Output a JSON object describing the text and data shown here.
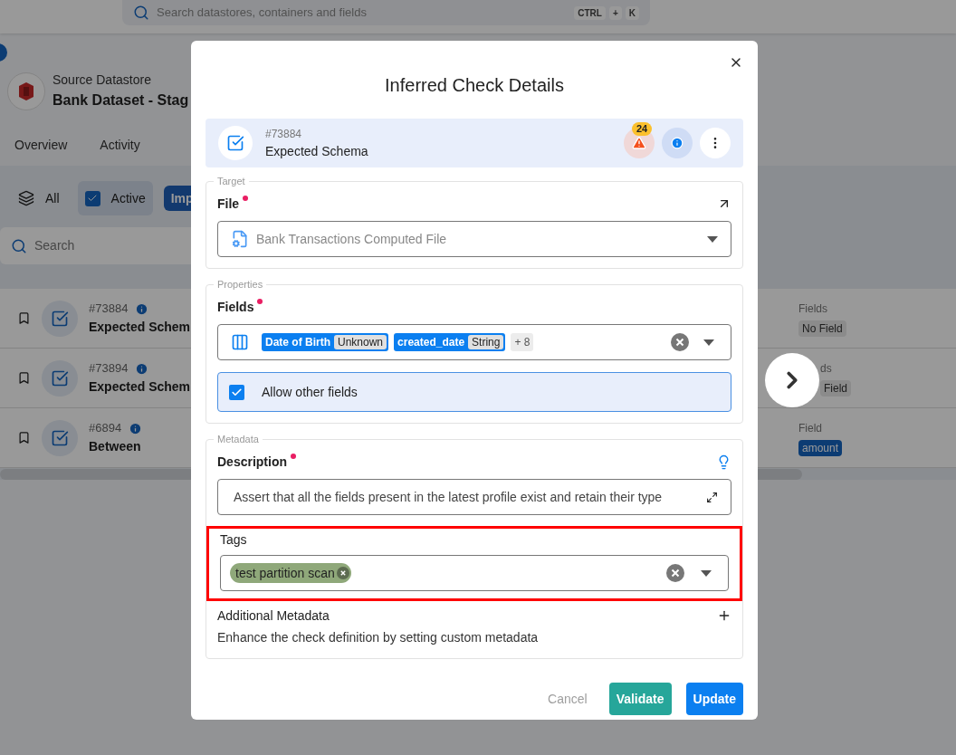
{
  "global_search": {
    "placeholder": "Search datastores, containers and fields",
    "shortcut": [
      "CTRL",
      "+",
      "K"
    ]
  },
  "datastore": {
    "caption": "Source Datastore",
    "name": "Bank Dataset - Stag"
  },
  "tabs": [
    {
      "label": "Overview",
      "selected": false
    },
    {
      "label": "Activity",
      "selected": false
    }
  ],
  "filters": [
    {
      "label": "All",
      "kind": "layers",
      "selected": false
    },
    {
      "label": "Active",
      "kind": "checkbox",
      "selected": true
    }
  ],
  "filter_button": "Imp",
  "list_search": {
    "placeholder": "Search"
  },
  "checks": [
    {
      "id": "#73884",
      "name": "Expected Schem",
      "field_label": "Fields",
      "field_value": "No Field",
      "kind": "empty"
    },
    {
      "id": "#73894",
      "name": "Expected Schem",
      "field_label": "ds",
      "field_value": "Field",
      "kind": "empty"
    },
    {
      "id": "#6894",
      "name": "Between",
      "field_label": "Field",
      "field_value": "amount",
      "kind": "field"
    }
  ],
  "modal": {
    "title": "Inferred Check Details",
    "check": {
      "id": "#73884",
      "name": "Expected Schema",
      "anomaly_count": "24"
    },
    "target": {
      "legend": "Target",
      "label": "File",
      "required": true,
      "value": "Bank Transactions Computed File"
    },
    "properties": {
      "legend": "Properties",
      "label": "Fields",
      "required": true,
      "fields": [
        {
          "name": "Date of Birth",
          "type": "Unknown"
        },
        {
          "name": "created_date",
          "type": "String"
        }
      ],
      "more": "+ 8",
      "allow_other": {
        "label": "Allow other fields",
        "checked": true
      }
    },
    "metadata": {
      "legend": "Metadata",
      "description_label": "Description",
      "required": true,
      "description": "Assert that all the fields present in the latest profile exist and retain their type",
      "tags_label": "Tags",
      "tags_highlighted": true,
      "tags": [
        {
          "label": "test partition scan",
          "color": "#8fa87a"
        }
      ],
      "additional_title": "Additional Metadata",
      "additional_text": "Enhance the check definition by setting custom metadata"
    },
    "buttons": [
      {
        "label": "Cancel",
        "kind": "text"
      },
      {
        "label": "Validate",
        "kind": "secondary"
      },
      {
        "label": "Update",
        "kind": "primary"
      }
    ]
  }
}
